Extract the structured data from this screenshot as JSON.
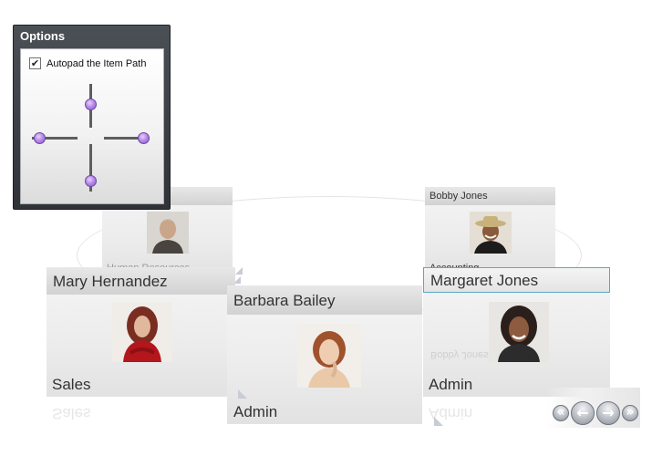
{
  "options": {
    "title": "Options",
    "autopad_label": "Autopad the Item Path",
    "autopad_checked": true,
    "check_glyph": "✔"
  },
  "carousel": {
    "back_left": {
      "name": "",
      "department": "Human Resources"
    },
    "back_right": {
      "name": "Bobby Jones",
      "department": "Accounting"
    },
    "front_left": {
      "name": "Mary Hernandez",
      "department": "Sales",
      "reflection": "Sales"
    },
    "front_center": {
      "name": "Barbara Bailey",
      "department": "Admin"
    },
    "front_right": {
      "name": "Margaret Jones",
      "department": "Admin",
      "reflection": "Admin",
      "reflection_behind": "Bobby Jones"
    }
  },
  "nav": {
    "first_icon": "double-left-icon",
    "prev_icon": "arrow-left-icon",
    "next_icon": "arrow-right-icon",
    "last_icon": "double-right-icon",
    "first_glyph": "«",
    "prev_glyph": "←",
    "next_glyph": "→",
    "last_glyph": "»"
  },
  "colors": {
    "thumb": "#b98be8",
    "selection_border": "#5aa7c8",
    "panel": "#3a3e43"
  }
}
